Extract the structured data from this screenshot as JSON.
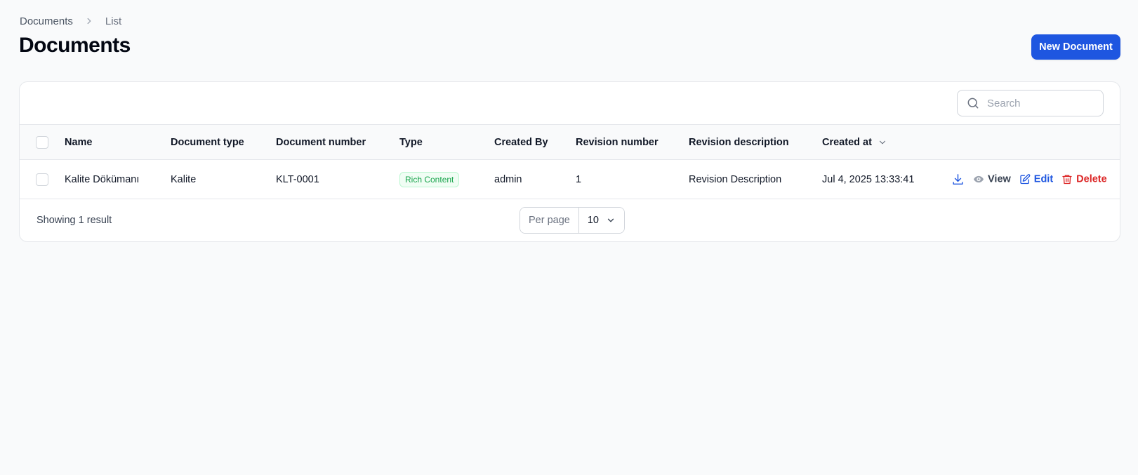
{
  "breadcrumb": {
    "root": "Documents",
    "current": "List"
  },
  "page": {
    "title": "Documents",
    "new_button": "New Document"
  },
  "search": {
    "placeholder": "Search"
  },
  "table": {
    "columns": {
      "name": "Name",
      "document_type": "Document type",
      "document_number": "Document number",
      "type": "Type",
      "created_by": "Created By",
      "revision_number": "Revision number",
      "revision_description": "Revision description",
      "created_at": "Created at"
    },
    "rows": [
      {
        "name": "Kalite Dökümanı",
        "document_type": "Kalite",
        "document_number": "KLT-0001",
        "type": "Rich Content",
        "created_by": "admin",
        "revision_number": "1",
        "revision_description": "Revision Description",
        "created_at": "Jul 4, 2025 13:33:41",
        "actions": {
          "view": "View",
          "edit": "Edit",
          "delete": "Delete"
        }
      }
    ]
  },
  "footer": {
    "showing": "Showing 1 result",
    "per_page_label": "Per page",
    "per_page_value": "10"
  },
  "icons": [
    "chevron-right-icon",
    "search-icon",
    "chevron-down-icon",
    "download-icon",
    "eye-icon",
    "edit-icon",
    "trash-icon"
  ],
  "colors": {
    "primary": "#1e56e0",
    "danger": "#dc2626",
    "success": "#16a34a"
  }
}
